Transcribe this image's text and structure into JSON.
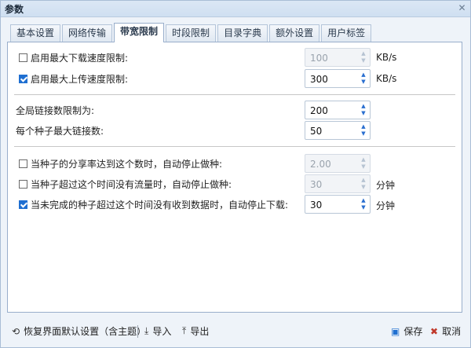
{
  "window": {
    "title": "参数",
    "close_glyph": "✕"
  },
  "tabs": [
    {
      "label": "基本设置",
      "active": false
    },
    {
      "label": "网络传输",
      "active": false
    },
    {
      "label": "带宽限制",
      "active": true
    },
    {
      "label": "时段限制",
      "active": false
    },
    {
      "label": "目录字典",
      "active": false
    },
    {
      "label": "额外设置",
      "active": false
    },
    {
      "label": "用户标签",
      "active": false
    }
  ],
  "bandwidth": {
    "download": {
      "label": "启用最大下载速度限制:",
      "checked": false,
      "value": "100",
      "unit": "KB/s",
      "disabled": true
    },
    "upload": {
      "label": "启用最大上传速度限制:",
      "checked": true,
      "value": "300",
      "unit": "KB/s",
      "disabled": false
    }
  },
  "connections": {
    "global": {
      "label": "全局链接数限制为:",
      "value": "200"
    },
    "per_torrent": {
      "label": "每个种子最大链接数:",
      "value": "50"
    }
  },
  "stop_rules": {
    "ratio": {
      "label": "当种子的分享率达到这个数时，自动停止做种:",
      "checked": false,
      "value": "2.00",
      "disabled": true
    },
    "no_traffic": {
      "label": "当种子超过这个时间没有流量时，自动停止做种:",
      "checked": false,
      "value": "30",
      "unit": "分钟",
      "disabled": true
    },
    "no_data": {
      "label": "当未完成的种子超过这个时间没有收到数据时，自动停止下载:",
      "checked": true,
      "value": "30",
      "unit": "分钟",
      "disabled": false
    }
  },
  "bottombar": {
    "restore": "恢复界面默认设置（含主题）",
    "import": "导入",
    "export": "导出",
    "save": "保存",
    "cancel": "取消"
  },
  "colors": {
    "accent": "#1f6fd1",
    "panel_border": "#98aecb"
  }
}
